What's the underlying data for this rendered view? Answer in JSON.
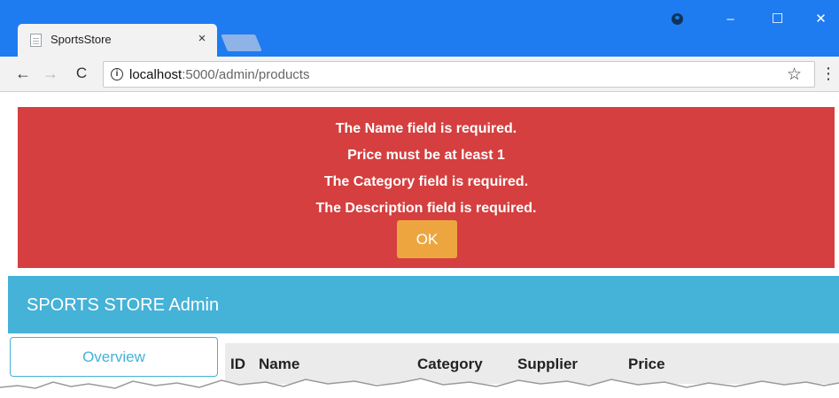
{
  "browser": {
    "tab_title": "SportsStore",
    "tab_close": "×",
    "url_host": "localhost",
    "url_path": ":5000/admin/products",
    "window_controls": {
      "minimize": "–",
      "maximize": "☐",
      "close": "✕"
    },
    "nav": {
      "back": "←",
      "forward": "→",
      "reload": "C"
    },
    "info_icon": "i",
    "star": "☆",
    "menu": "⋮",
    "accent_color": "#1e7cf0"
  },
  "alert": {
    "lines": [
      "The Name field is required.",
      "Price must be at least 1",
      "The Category field is required.",
      "The Description field is required."
    ],
    "ok_label": "OK",
    "color": "#d53f3f",
    "button_color": "#eda63f"
  },
  "banner": {
    "title": "SPORTS STORE Admin",
    "color": "#45b2d7"
  },
  "sidebar": {
    "overview_label": "Overview"
  },
  "table": {
    "columns": [
      "ID",
      "Name",
      "Category",
      "Supplier",
      "Price"
    ]
  }
}
